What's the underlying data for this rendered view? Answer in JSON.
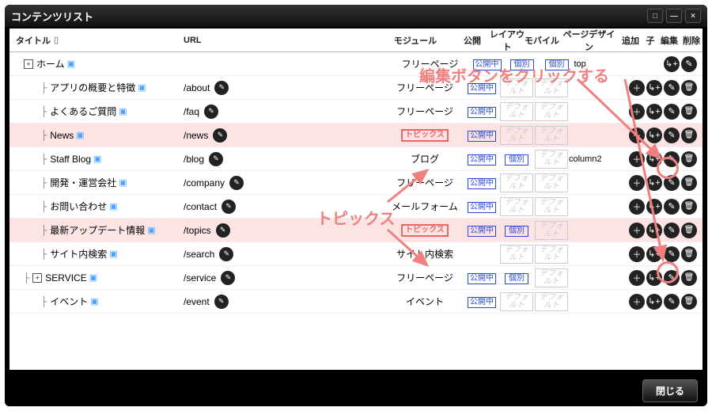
{
  "window": {
    "title": "コンテンツリスト"
  },
  "columns": {
    "title": "タイトル",
    "url": "URL",
    "module": "モジュール",
    "publish": "公開",
    "layout": "レイアウト",
    "mobile": "モバイル",
    "page_design": "ページデザイン",
    "add": "追加",
    "child": "子",
    "edit": "編集",
    "delete": "削除"
  },
  "badges": {
    "publishing": "公開中",
    "individual": "個別",
    "default_disabled": "デフォルト"
  },
  "rows": [
    {
      "indent": 0,
      "expand": "+",
      "title": "ホーム",
      "url": "",
      "module": "フリーページ",
      "publish": true,
      "layout": "個別",
      "mobile": "個別",
      "page_design": "top",
      "highlight": false,
      "mod_hl": false,
      "actions": [
        "child",
        "edit"
      ]
    },
    {
      "indent": 1,
      "title": "アプリの概要と特徴",
      "url": "/about",
      "module": "フリーページ",
      "publish": true,
      "layout": "dis",
      "mobile": "dis",
      "page_design": "",
      "highlight": false,
      "mod_hl": false
    },
    {
      "indent": 1,
      "title": "よくあるご質問",
      "url": "/faq",
      "module": "フリーページ",
      "publish": true,
      "layout": "dis",
      "mobile": "dis",
      "page_design": "",
      "highlight": false,
      "mod_hl": false
    },
    {
      "indent": 1,
      "title": "News",
      "url": "/news",
      "module": "トピックス",
      "publish": true,
      "layout": "dis",
      "mobile": "dis",
      "page_design": "",
      "highlight": true,
      "mod_hl": true
    },
    {
      "indent": 1,
      "title": "Staff Blog",
      "url": "/blog",
      "module": "ブログ",
      "publish": true,
      "layout": "個別",
      "mobile": "dis",
      "page_design": "column2",
      "highlight": false,
      "mod_hl": false
    },
    {
      "indent": 1,
      "title": "開発・運営会社",
      "url": "/company",
      "module": "フリーページ",
      "publish": true,
      "layout": "dis",
      "mobile": "dis",
      "page_design": "",
      "highlight": false,
      "mod_hl": false
    },
    {
      "indent": 1,
      "title": "お問い合わせ",
      "url": "/contact",
      "module": "メールフォーム",
      "publish": true,
      "layout": "dis",
      "mobile": "dis",
      "page_design": "",
      "highlight": false,
      "mod_hl": false
    },
    {
      "indent": 1,
      "title": "最新アップデート情報",
      "url": "/topics",
      "module": "トピックス",
      "publish": true,
      "layout": "個別",
      "mobile": "dis",
      "page_design": "",
      "highlight": true,
      "mod_hl": true
    },
    {
      "indent": 1,
      "title": "サイト内検索",
      "url": "/search",
      "module": "サイト内検索",
      "publish": false,
      "layout": "dis",
      "mobile": "dis",
      "page_design": "",
      "highlight": false,
      "mod_hl": false
    },
    {
      "indent": 0,
      "expand": "+",
      "branch_child": true,
      "title": "SERVICE",
      "url": "/service",
      "module": "フリーページ",
      "publish": true,
      "layout": "個別",
      "mobile": "dis",
      "page_design": "",
      "highlight": false,
      "mod_hl": false
    },
    {
      "indent": 1,
      "title": "イベント",
      "url": "/event",
      "module": "イベント",
      "publish": true,
      "layout": "dis",
      "mobile": "dis",
      "page_design": "",
      "highlight": false,
      "mod_hl": false
    }
  ],
  "footer": {
    "close": "閉じる"
  },
  "annotations": {
    "topics_label": "トピックス",
    "edit_hint": "編集ボタンをクリックする"
  }
}
